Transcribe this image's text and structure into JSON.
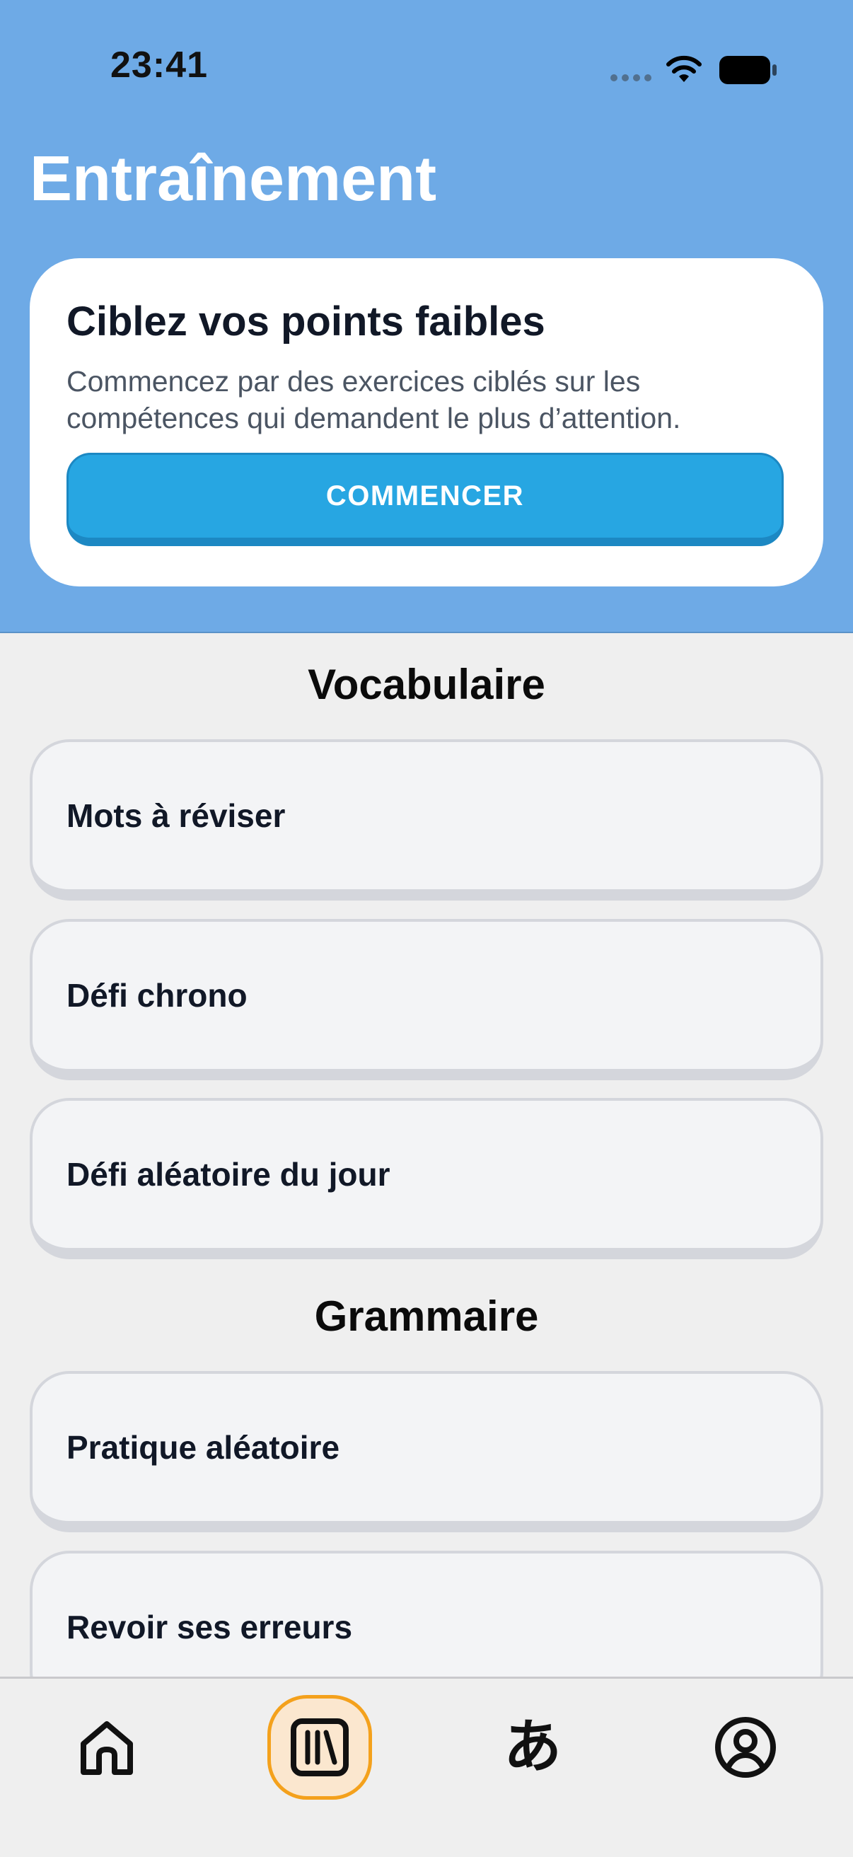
{
  "status_bar": {
    "time": "23:41",
    "icons": [
      "signal-dots-icon",
      "wifi-icon",
      "battery-icon"
    ]
  },
  "header": {
    "title": "Entraînement"
  },
  "focus_card": {
    "title": "Ciblez vos points faibles",
    "description": "Commencez par des exercices ciblés sur les compétences qui demandent le plus d’attention.",
    "button_label": "COMMENCER"
  },
  "sections": [
    {
      "title": "Vocabulaire",
      "items": [
        {
          "label": "Mots à réviser"
        },
        {
          "label": "Défi chrono"
        },
        {
          "label": "Défi aléatoire du jour"
        }
      ]
    },
    {
      "title": "Grammaire",
      "items": [
        {
          "label": "Pratique aléatoire"
        },
        {
          "label": "Revoir ses erreurs"
        }
      ]
    }
  ],
  "tab_bar": {
    "tabs": [
      {
        "icon": "home-icon",
        "active": false
      },
      {
        "icon": "library-icon",
        "active": true
      },
      {
        "icon": "hiragana-icon",
        "glyph": "あ",
        "active": false
      },
      {
        "icon": "profile-icon",
        "active": false
      }
    ]
  },
  "colors": {
    "header_bg": "#6eaae6",
    "accent": "#27a6e2",
    "active_tab_border": "#f4a11c",
    "active_tab_bg": "#fbe7cf"
  }
}
